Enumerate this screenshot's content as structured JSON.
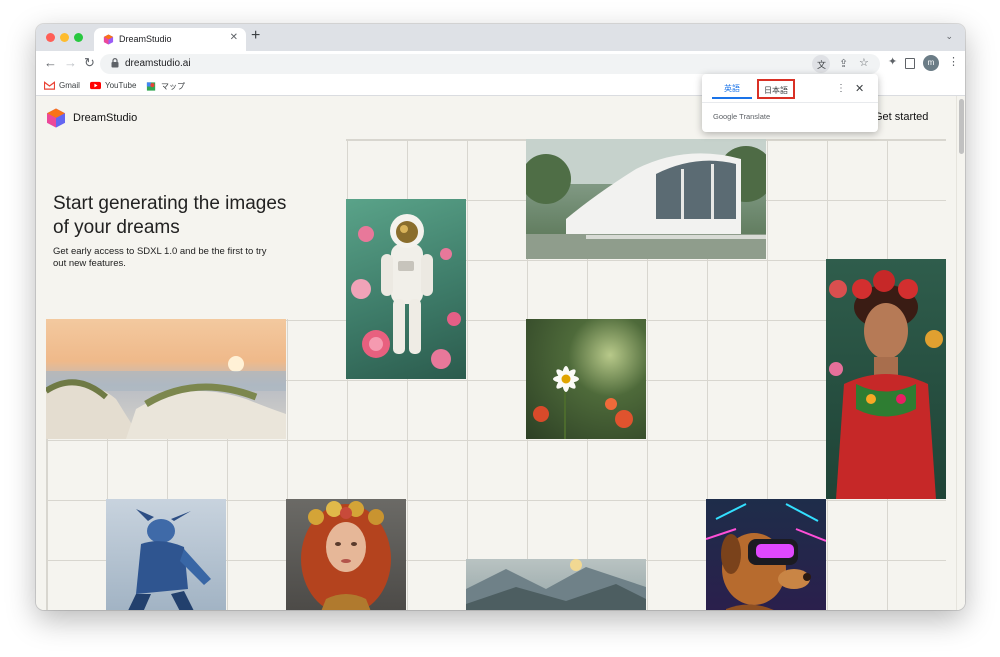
{
  "browser": {
    "tab_title": "DreamStudio",
    "url": "dreamstudio.ai",
    "bookmarks": [
      {
        "label": "Gmail",
        "icon": "gmail-icon"
      },
      {
        "label": "YouTube",
        "icon": "youtube-icon"
      },
      {
        "label": "マップ",
        "icon": "maps-icon"
      }
    ],
    "avatar_letter": "m"
  },
  "translate_popup": {
    "source_lang": "英語",
    "target_lang": "日本語",
    "brand_google": "Google",
    "brand_translate": "Translate"
  },
  "page": {
    "brand": "DreamStudio",
    "cta": "Get started",
    "hero_title": "Start generating the images of your dreams",
    "hero_subtitle": "Get early access to SDXL 1.0 and be the first to try out new features."
  },
  "colors": {
    "highlight_box": "#d93025",
    "tab_active": "#1a73e8"
  }
}
